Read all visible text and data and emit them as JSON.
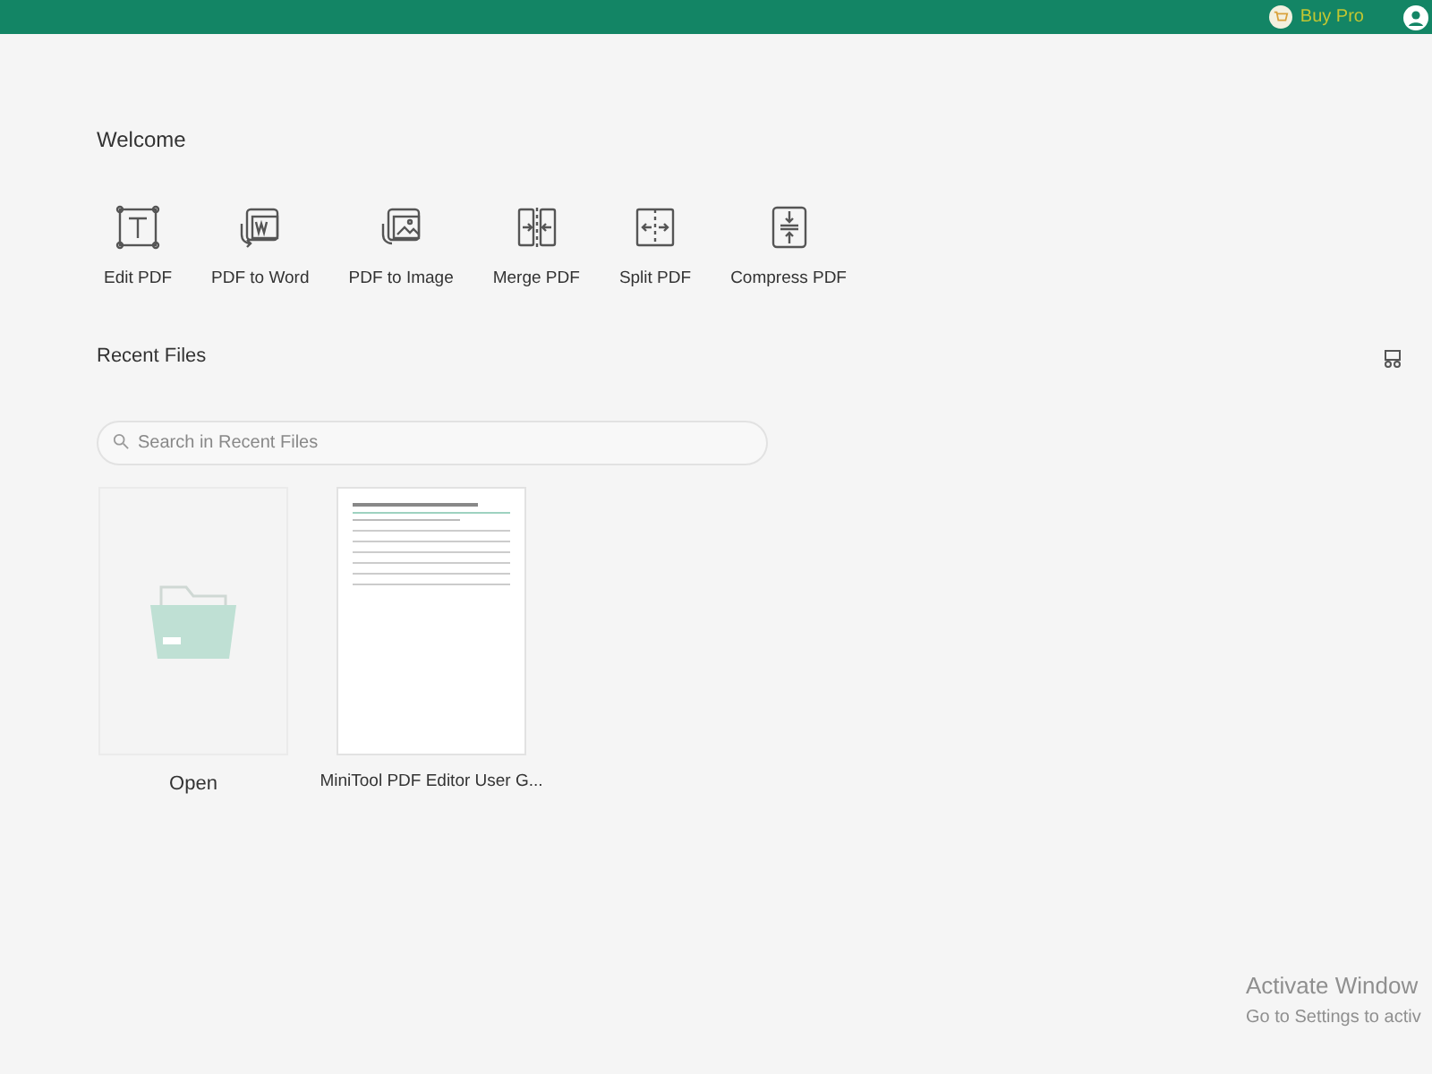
{
  "header": {
    "buy_label": "Buy Pro"
  },
  "welcome": {
    "title": "Welcome",
    "tools": [
      {
        "kind": "edit",
        "label": "Edit PDF"
      },
      {
        "kind": "word",
        "label": "PDF to Word"
      },
      {
        "kind": "image",
        "label": "PDF to Image"
      },
      {
        "kind": "merge",
        "label": "Merge PDF"
      },
      {
        "kind": "split",
        "label": "Split PDF"
      },
      {
        "kind": "compress",
        "label": "Compress PDF"
      }
    ]
  },
  "recent": {
    "title": "Recent Files",
    "search": {
      "placeholder": "Search in Recent Files"
    },
    "files": [
      {
        "kind": "open",
        "label": "Open"
      },
      {
        "kind": "document",
        "label": "MiniTool PDF Editor User G..."
      }
    ]
  },
  "activation_notice": {
    "title": "Activate Window",
    "subtitle": "Go to Settings to activ"
  }
}
